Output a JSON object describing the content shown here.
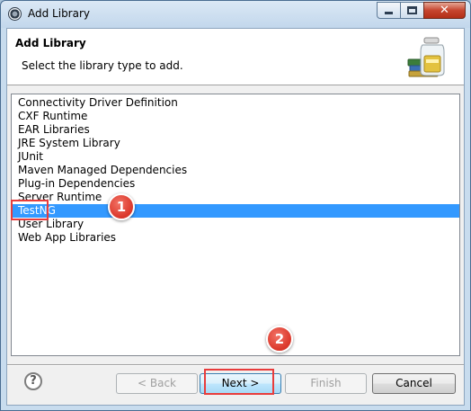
{
  "window": {
    "title": "Add Library",
    "close_glyph": "✕"
  },
  "header": {
    "title": "Add Library",
    "description": "Select the library type to add.",
    "icon": "library-jar-icon"
  },
  "library_list": {
    "items": [
      "Connectivity Driver Definition",
      "CXF Runtime",
      "EAR Libraries",
      "JRE System Library",
      "JUnit",
      "Maven Managed Dependencies",
      "Plug-in Dependencies",
      "Server Runtime",
      "TestNG",
      "User Library",
      "Web App Libraries"
    ],
    "selected": "TestNG",
    "selection_color": "#3399ff"
  },
  "annotations": {
    "step1": "1",
    "step2": "2",
    "color": "#e83c3c"
  },
  "footer": {
    "help_glyph": "?",
    "back_label": "< Back",
    "next_label": "Next >",
    "finish_label": "Finish",
    "cancel_label": "Cancel"
  }
}
